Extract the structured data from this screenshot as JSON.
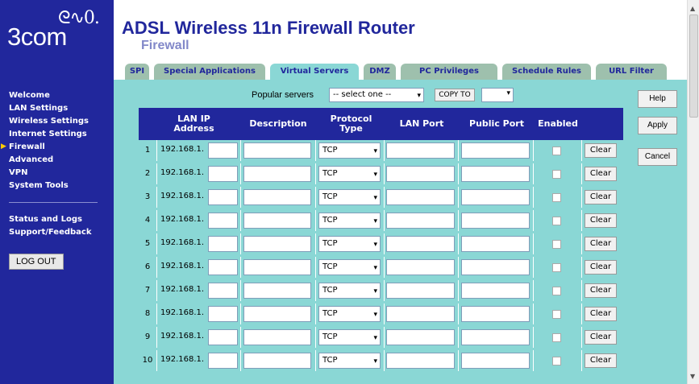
{
  "brand": {
    "logo_mark": "ᘓ∿0.",
    "logo_text": "3com"
  },
  "header": {
    "title": "ADSL Wireless 11n Firewall Router",
    "subtitle": "Firewall"
  },
  "tabs": [
    "SPI",
    "Special Applications",
    "Virtual Servers",
    "DMZ",
    "PC Privileges",
    "Schedule Rules",
    "URL Filter"
  ],
  "nav": {
    "items": [
      "Welcome",
      "LAN Settings",
      "Wireless Settings",
      "Internet Settings",
      "Firewall",
      "Advanced",
      "VPN",
      "System Tools"
    ],
    "items2": [
      "Status and Logs",
      "Support/Feedback"
    ],
    "logout": "LOG OUT"
  },
  "popular": {
    "label": "Popular servers",
    "select_value": "-- select one --",
    "copy_to": "COPY TO"
  },
  "table": {
    "headers": [
      "LAN IP Address",
      "Description",
      "Protocol Type",
      "LAN Port",
      "Public Port",
      "Enabled"
    ],
    "rows": [
      {
        "num": "1",
        "ip": "192.168.1.",
        "protocol": "TCP",
        "clear": "Clear"
      },
      {
        "num": "2",
        "ip": "192.168.1.",
        "protocol": "TCP",
        "clear": "Clear"
      },
      {
        "num": "3",
        "ip": "192.168.1.",
        "protocol": "TCP",
        "clear": "Clear"
      },
      {
        "num": "4",
        "ip": "192.168.1.",
        "protocol": "TCP",
        "clear": "Clear"
      },
      {
        "num": "5",
        "ip": "192.168.1.",
        "protocol": "TCP",
        "clear": "Clear"
      },
      {
        "num": "6",
        "ip": "192.168.1.",
        "protocol": "TCP",
        "clear": "Clear"
      },
      {
        "num": "7",
        "ip": "192.168.1.",
        "protocol": "TCP",
        "clear": "Clear"
      },
      {
        "num": "8",
        "ip": "192.168.1.",
        "protocol": "TCP",
        "clear": "Clear"
      },
      {
        "num": "9",
        "ip": "192.168.1.",
        "protocol": "TCP",
        "clear": "Clear"
      },
      {
        "num": "10",
        "ip": "192.168.1.",
        "protocol": "TCP",
        "clear": "Clear"
      }
    ]
  },
  "side_buttons": [
    "Help",
    "Apply",
    "Cancel"
  ],
  "colors": {
    "nav_bg": "#21279c",
    "content_bg": "#8ad7d5",
    "tab_bg": "#9ec0ad",
    "accent": "#21279c"
  }
}
